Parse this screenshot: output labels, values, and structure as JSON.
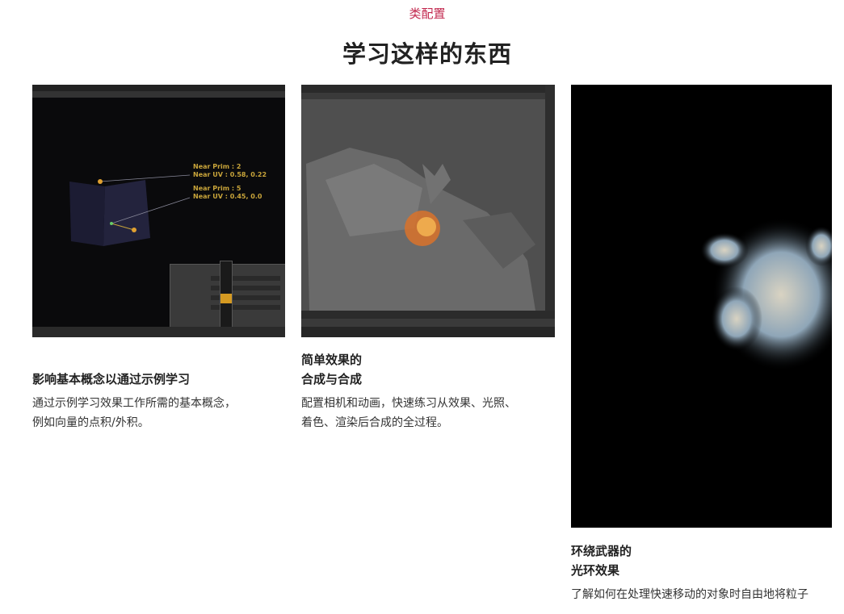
{
  "section": {
    "eyebrow": "类配置",
    "title": "学习这样的东西"
  },
  "cards": [
    {
      "title": "影响基本概念以通过示例学习",
      "description": "通过示例学习效果工作所需的基本概念，\n例如向量的点积/外积。",
      "image_overlay": {
        "line1": "Near Prim : 2\nNear UV : 0.58, 0.22",
        "line2": "Near Prim : 5\nNear UV : 0.45, 0.0"
      }
    },
    {
      "title": "简单效果的\n合成与合成",
      "description": "配置相机和动画，快速练习从效果、光照、\n着色、渲染后合成的全过程。"
    },
    {
      "title": "环绕武器的\n光环效果",
      "description": "了解如何在处理快速移动的对象时自由地将粒子"
    }
  ],
  "colors": {
    "accent": "#c2284e",
    "text": "#222222"
  }
}
